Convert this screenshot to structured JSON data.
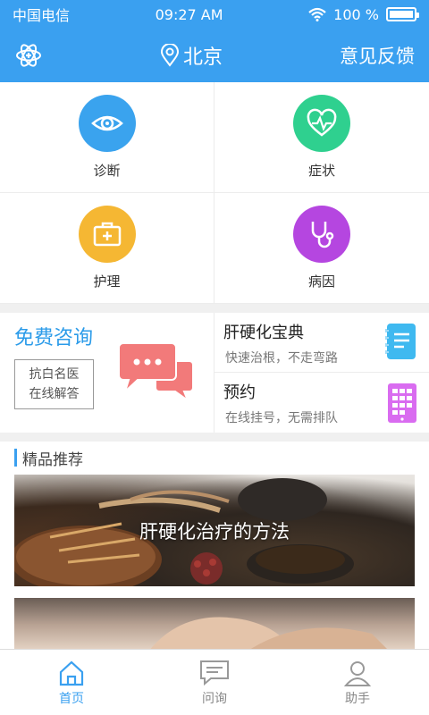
{
  "status_bar": {
    "carrier": "中国电信",
    "time": "09:27 AM",
    "battery": "100 %",
    "battery_level": 1.0
  },
  "navbar": {
    "city": "北京",
    "feedback": "意见反馈"
  },
  "categories": [
    {
      "label": "诊断",
      "icon": "eye-icon",
      "color": "#3aa3ee"
    },
    {
      "label": "症状",
      "icon": "heart-pulse-icon",
      "color": "#2fd08f"
    },
    {
      "label": "护理",
      "icon": "first-aid-kit-icon",
      "color": "#f5b733"
    },
    {
      "label": "病因",
      "icon": "stethoscope-icon",
      "color": "#b546e0"
    }
  ],
  "promo": {
    "free_title": "免费咨询",
    "free_line1": "抗白名医",
    "free_line2": "在线解答",
    "handbook_title": "肝硬化宝典",
    "handbook_sub": "快速治根，不走弯路",
    "booking_title": "预约",
    "booking_sub": "在线挂号，无需排队"
  },
  "recommend": {
    "title": "精品推荐",
    "banner_caption": "肝硬化治疗的方法"
  },
  "tabs": [
    {
      "label": "首页",
      "icon": "home-icon",
      "active": true
    },
    {
      "label": "问询",
      "icon": "chat-icon",
      "active": false
    },
    {
      "label": "助手",
      "icon": "person-icon",
      "active": false
    }
  ],
  "colors": {
    "primary": "#3aa0f0",
    "chat_art": "#f27a7a",
    "handbook_icon": "#3fb9f0",
    "booking_icon": "#d96cf0"
  }
}
